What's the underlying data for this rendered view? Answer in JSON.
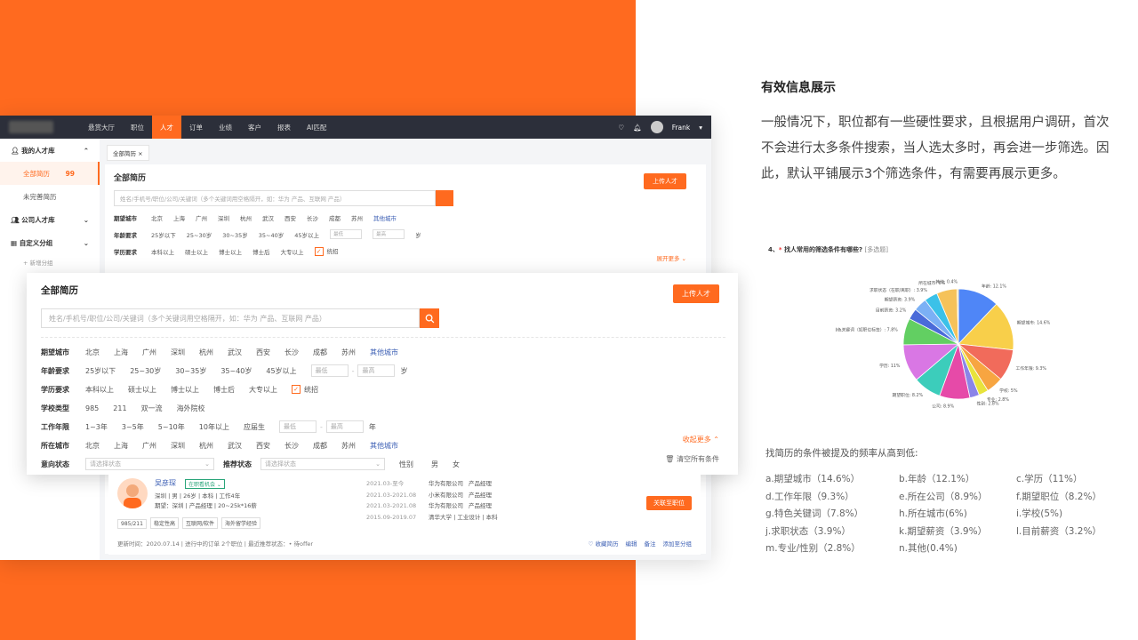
{
  "app": {
    "nav": [
      "悬赏大厅",
      "职位",
      "人才",
      "订单",
      "业绩",
      "客户",
      "报表",
      "AI匹配"
    ],
    "active_nav": "人才",
    "user": "Frank",
    "sidebar": {
      "group1": "我的人才库",
      "items": [
        {
          "label": "全部简历",
          "count": "99"
        },
        {
          "label": "未完善简历",
          "count": ""
        }
      ],
      "group2": "公司人才库",
      "group3": "自定义分组",
      "add": "+ 新增分组"
    },
    "tab": "全部简历 ×",
    "panel_title": "全部简历",
    "upload": "上传人才",
    "search_placeholder": "姓名/手机号/职位/公司/关键词（多个关键词用空格隔开，如：华为 产品、互联网 产品）",
    "filters": {
      "city_label": "期望城市",
      "cities": [
        "北京",
        "上海",
        "广州",
        "深圳",
        "杭州",
        "武汉",
        "西安",
        "长沙",
        "成都",
        "苏州"
      ],
      "other_city": "其他城市",
      "age_label": "年龄要求",
      "ages": [
        "25岁以下",
        "25~30岁",
        "30~35岁",
        "35~40岁",
        "45岁以上"
      ],
      "min": "最低",
      "max": "最高",
      "age_unit": "岁",
      "edu_label": "学历要求",
      "edus": [
        "本科以上",
        "硕士以上",
        "博士以上",
        "博士后",
        "大专以上"
      ],
      "unified": "统招",
      "expand": "展开更多 ⌄"
    },
    "card": {
      "title": "全部简历",
      "upload": "上传人才",
      "search_placeholder": "姓名/手机号/职位/公司/关键词（多个关键词用空格隔开，如：华为 产品、互联网 产品）",
      "city_label": "期望城市",
      "cities": [
        "北京",
        "上海",
        "广州",
        "深圳",
        "杭州",
        "武汉",
        "西安",
        "长沙",
        "成都",
        "苏州"
      ],
      "other_city": "其他城市",
      "age_label": "年龄要求",
      "ages": [
        "25岁以下",
        "25~30岁",
        "30~35岁",
        "35~40岁",
        "45岁以上"
      ],
      "min": "最低",
      "max": "最高",
      "age_unit": "岁",
      "edu_label": "学历要求",
      "edus": [
        "本科以上",
        "硕士以上",
        "博士以上",
        "博士后",
        "大专以上"
      ],
      "unified": "统招",
      "school_label": "学校类型",
      "schools": [
        "985",
        "211",
        "双一流",
        "海外院校"
      ],
      "work_label": "工作年限",
      "works": [
        "1~3年",
        "3~5年",
        "5~10年",
        "10年以上",
        "应届生"
      ],
      "work_unit": "年",
      "loc_label": "所在城市",
      "loc_cities": [
        "北京",
        "上海",
        "广州",
        "深圳",
        "杭州",
        "武汉",
        "西安",
        "长沙",
        "成都",
        "苏州"
      ],
      "loc_other": "其他城市",
      "collapse": "收起更多 ⌃",
      "intent_label": "意向状态",
      "intent_ph": "请选择状态",
      "rec_label": "推荐状态",
      "rec_ph": "请选择状态",
      "gender_label": "性别",
      "genders": [
        "男",
        "女"
      ],
      "clear": "清空所有条件"
    },
    "candidate": {
      "name": "吴彦琛",
      "status": "在职看机会 ⌄",
      "line1": "深圳 | 男 | 26岁 | 本科 | 工作4年",
      "line2": "期望：深圳 | 产品经理 | 20~25k*16薪",
      "tags": [
        "985/211",
        "稳定性高",
        "互联网/软件",
        "海外留学经验"
      ],
      "history": [
        {
          "date": "2021.03-至今",
          "company": "华为有限公司",
          "role": "产品经理"
        },
        {
          "date": "2021.03-2021.08",
          "company": "小米有限公司",
          "role": "产品经理"
        },
        {
          "date": "2021.03-2021.08",
          "company": "华为有限公司",
          "role": "产品经理"
        },
        {
          "date": "2015.09-2019.07",
          "company": "清华大学 | 工业设计 | 本科",
          "role": ""
        }
      ],
      "match": "关联至职位",
      "foot": "更新时间：2020.07.14 | 进行中的订单 2个职位 | 最近推荐状态：• 待offer",
      "actions": [
        "♡ 收藏简历",
        "编辑",
        "备注",
        "添加至分组"
      ]
    }
  },
  "right": {
    "title": "有效信息展示",
    "para": "一般情况下，职位都有一些硬性要求，且根据用户调研，首次不会进行太多条件搜索，当人选太多时，再会进一步筛选。因此，默认平铺展示3个筛选条件，有需要再展示更多。",
    "question_num": "4、",
    "question_req": "*",
    "question": "找人常用的筛选条件有哪些?",
    "question_type": "[多选题]",
    "freq_title": "找简历的条件被提及的频率从高到低:",
    "freq": [
      "a.期望城市（14.6%）",
      "b.年龄（12.1%）",
      "c.学历（11%）",
      "d.工作年限（9.3%）",
      "e.所在公司（8.9%）",
      "f.期望职位（8.2%）",
      "g.特色关键词（7.8%）",
      "h.所在城市(6%)",
      "i.学校(5%)",
      "j.求职状态（3.9%）",
      "k.期望薪资（3.9%）",
      "l.目前薪资（3.2%）",
      "m.专业/性别（2.8%）",
      "n.其他(0.4%)"
    ]
  },
  "chart_data": {
    "type": "pie",
    "categories": [
      "年龄",
      "期望城市",
      "工作年限",
      "学校",
      "专业",
      "性别",
      "公司",
      "期望职位",
      "学历",
      "特色关键词（如职位标签）",
      "目前薪资",
      "期望薪资",
      "求职状态（在职/离职）",
      "所在城市",
      "其他"
    ],
    "values": [
      12.1,
      14.6,
      9.3,
      5,
      2.8,
      2.8,
      8.9,
      8.2,
      11,
      7.8,
      3.2,
      3.9,
      3.9,
      6,
      0.4
    ],
    "labels": [
      "年龄: 12.1%",
      "期望城市: 14.6%",
      "工作年限: 9.3%",
      "学校: 5%",
      "专业: 2.8%",
      "性别: 2.8%",
      "公司: 8.9%",
      "期望职位: 8.2%",
      "学历: 11%",
      "特色关键词（如职位标签）: 7.8%",
      "目前薪资: 3.2%",
      "期望薪资: 3.9%",
      "求职状态（在职/离职）: 3.9%",
      "所在城市: 6%",
      "其他: 0.4%"
    ],
    "colors": [
      "#4f86f7",
      "#f8cf4a",
      "#f16b5b",
      "#f7a541",
      "#e8e33c",
      "#8a84e8",
      "#e64aa8",
      "#3ccdbb",
      "#d977e4",
      "#62cf62",
      "#4a6bd9",
      "#7bb0f5",
      "#3bc1e8",
      "#f5c25a",
      "#f0d070"
    ]
  }
}
